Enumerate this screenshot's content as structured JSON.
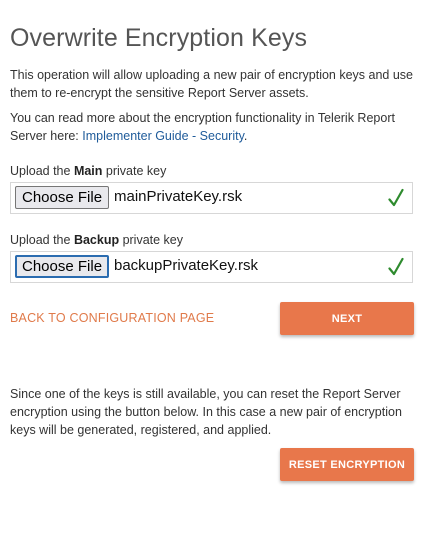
{
  "page": {
    "title": "Overwrite Encryption Keys",
    "intro": "This operation will allow uploading a new pair of encryption keys and use them to re-encrypt the sensitive Report Server assets.",
    "more_info_prefix": "You can read more about the encryption functionality in Telerik Report Server here: ",
    "more_info_link": "Implementer Guide - Security",
    "more_info_suffix": "."
  },
  "main_key": {
    "label_prefix": "Upload the ",
    "label_bold": "Main",
    "label_suffix": " private key",
    "button_label": "Choose File",
    "file_name": "mainPrivateKey.rsk",
    "status_icon": "check-icon",
    "status_color": "#2e8b2e"
  },
  "backup_key": {
    "label_prefix": "Upload the ",
    "label_bold": "Backup",
    "label_suffix": " private key",
    "button_label": "Choose File",
    "file_name": "backupPrivateKey.rsk",
    "status_icon": "check-icon",
    "status_color": "#2e8b2e"
  },
  "actions": {
    "back_label": "BACK TO CONFIGURATION PAGE",
    "next_label": "NEXT",
    "accent_color": "#e8774b"
  },
  "reset": {
    "text": "Since one of the keys is still available, you can reset the Report Server encryption using the button below. In this case a new pair of encryption keys will be generated, registered, and applied.",
    "button_label": "RESET ENCRYPTION"
  }
}
